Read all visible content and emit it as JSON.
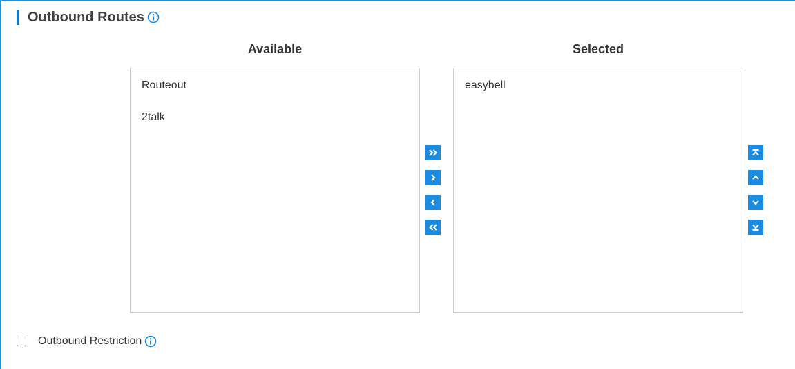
{
  "section": {
    "title": "Outbound Routes"
  },
  "available": {
    "header": "Available",
    "items": [
      "Routeout",
      "2talk"
    ]
  },
  "selected": {
    "header": "Selected",
    "items": [
      "easybell"
    ]
  },
  "transfer_buttons": [
    {
      "name": "move-all-right-button",
      "icon": "double-chevron-right-icon"
    },
    {
      "name": "move-right-button",
      "icon": "chevron-right-icon"
    },
    {
      "name": "move-left-button",
      "icon": "chevron-left-icon"
    },
    {
      "name": "move-all-left-button",
      "icon": "double-chevron-left-icon"
    }
  ],
  "order_buttons": [
    {
      "name": "move-top-button",
      "icon": "move-to-top-icon"
    },
    {
      "name": "move-up-button",
      "icon": "chevron-up-icon"
    },
    {
      "name": "move-down-button",
      "icon": "chevron-down-icon"
    },
    {
      "name": "move-bottom-button",
      "icon": "move-to-bottom-icon"
    }
  ],
  "restriction": {
    "label": "Outbound Restriction",
    "checked": false
  },
  "colors": {
    "accent": "#1a8be0",
    "border": "#cccccc",
    "text": "#333333"
  }
}
